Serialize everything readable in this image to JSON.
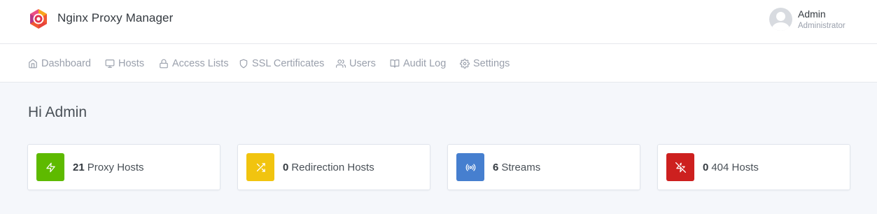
{
  "header": {
    "brand": "Nginx Proxy Manager",
    "user": {
      "name": "Admin",
      "role": "Administrator"
    }
  },
  "nav": {
    "items": [
      {
        "label": "Dashboard",
        "icon": "home-icon"
      },
      {
        "label": "Hosts",
        "icon": "monitor-icon"
      },
      {
        "label": "Access Lists",
        "icon": "lock-icon"
      },
      {
        "label": "SSL Certificates",
        "icon": "shield-icon"
      },
      {
        "label": "Users",
        "icon": "users-icon"
      },
      {
        "label": "Audit Log",
        "icon": "book-icon"
      },
      {
        "label": "Settings",
        "icon": "gear-icon"
      }
    ]
  },
  "main": {
    "greeting": "Hi Admin",
    "cards": [
      {
        "count": "21",
        "label": "Proxy Hosts",
        "icon": "zap-icon",
        "color": "#5eba00"
      },
      {
        "count": "0",
        "label": "Redirection Hosts",
        "icon": "shuffle-icon",
        "color": "#f1c40f"
      },
      {
        "count": "6",
        "label": "Streams",
        "icon": "radio-icon",
        "color": "#467fcf"
      },
      {
        "count": "0",
        "label": "404 Hosts",
        "icon": "zap-off-icon",
        "color": "#cd201f"
      }
    ]
  }
}
